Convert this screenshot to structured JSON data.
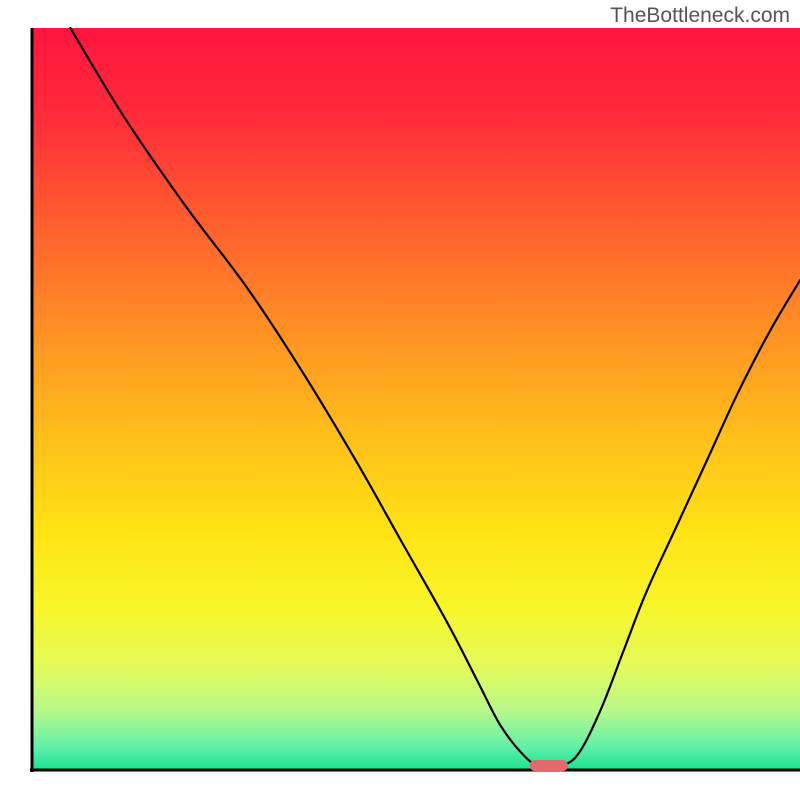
{
  "watermark": "TheBottleneck.com",
  "chart_data": {
    "type": "line",
    "title": "",
    "xlabel": "",
    "ylabel": "",
    "xlim": [
      0,
      100
    ],
    "ylim": [
      0,
      100
    ],
    "axes": {
      "left_visible": true,
      "bottom_visible": true,
      "color": "#000000",
      "width": 3
    },
    "background_gradient": {
      "stops": [
        {
          "offset": 0.0,
          "color": "#ff153f"
        },
        {
          "offset": 0.12,
          "color": "#ff2b3a"
        },
        {
          "offset": 0.25,
          "color": "#ff5a2f"
        },
        {
          "offset": 0.4,
          "color": "#ff8e24"
        },
        {
          "offset": 0.55,
          "color": "#ffbf1a"
        },
        {
          "offset": 0.68,
          "color": "#ffe314"
        },
        {
          "offset": 0.78,
          "color": "#f8f628"
        },
        {
          "offset": 0.86,
          "color": "#e4fa5a"
        },
        {
          "offset": 0.92,
          "color": "#b8f98a"
        },
        {
          "offset": 0.97,
          "color": "#5ef0a8"
        },
        {
          "offset": 1.0,
          "color": "#18e28f"
        }
      ]
    },
    "series": [
      {
        "name": "bottleneck-curve",
        "color": "#000000",
        "width": 2.2,
        "x": [
          5,
          12,
          20,
          28,
          35,
          42,
          48,
          54,
          58,
          61,
          64,
          66,
          68.5,
          71,
          74,
          77,
          80,
          84,
          88,
          92,
          96,
          100
        ],
        "y": [
          100,
          88,
          76,
          65,
          54,
          42,
          31,
          20,
          12,
          6,
          2,
          0.6,
          0.6,
          2,
          8,
          16,
          24,
          33,
          42,
          51,
          59,
          66
        ]
      }
    ],
    "marker": {
      "name": "optimal-range",
      "shape": "capsule",
      "x_center": 67.3,
      "y_center": 0.6,
      "width": 5.0,
      "height": 1.5,
      "fill": "#e26a6a"
    }
  }
}
